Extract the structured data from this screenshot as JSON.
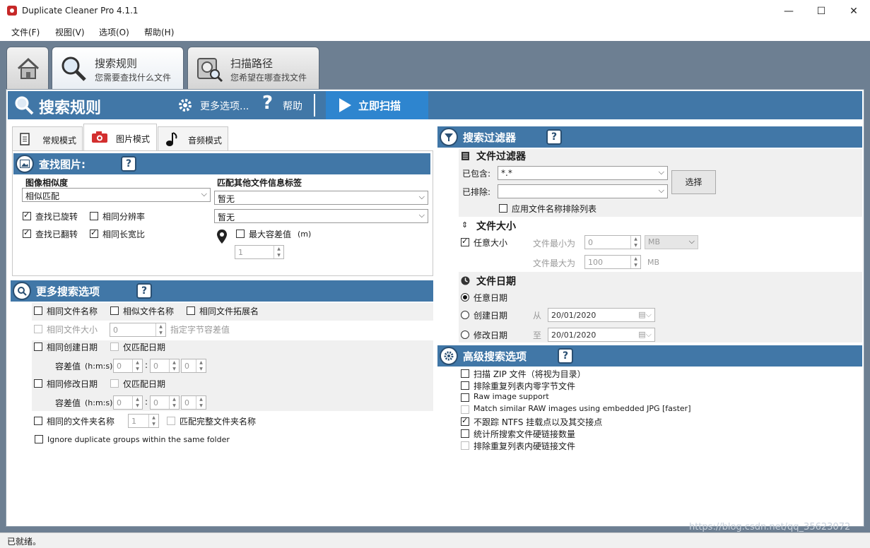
{
  "window": {
    "title": "Duplicate Cleaner Pro 4.1.1",
    "minimize": "—",
    "maximize": "☐",
    "close": "✕"
  },
  "menu": [
    "文件(F)",
    "视图(V)",
    "选项(O)",
    "帮助(H)"
  ],
  "tabs": [
    {
      "title": "",
      "subtitle": ""
    },
    {
      "title": "搜索规则",
      "subtitle": "您需要查找什么文件"
    },
    {
      "title": "扫描路径",
      "subtitle": "您希望在哪查找文件"
    }
  ],
  "header": {
    "title": "搜索规则",
    "more": "更多选项...",
    "help": "帮助",
    "scan": "立即扫描"
  },
  "subtabs": [
    "常规模式",
    "图片模式",
    "音频模式"
  ],
  "find_images": {
    "title": "查找图片:",
    "similarity_label": "图像相似度",
    "similarity_value": "相似匹配",
    "tags_label": "匹配其他文件信息标签",
    "tag1": "暂无",
    "tag2": "暂无",
    "rotated": "查找已旋转",
    "flipped": "查找已翻转",
    "same_resolution": "相同分辨率",
    "same_aspect": "相同长宽比",
    "max_tolerance": "最大容差值",
    "max_tolerance_unit": "(m)",
    "tolerance_value": "1"
  },
  "more_search": {
    "title": "更多搜索选项",
    "same_name": "相同文件名称",
    "similar_name": "相似文件名称",
    "same_ext": "相同文件拓展名",
    "same_size": "相同文件大小",
    "size_value": "0",
    "byte_tol": "指定字节容差值",
    "same_created": "相同创建日期",
    "date_only_1": "仅匹配日期",
    "tolerance": "容差值",
    "hms": "(h:m:s)",
    "zero": "0",
    "colon": ":",
    "same_modified": "相同修改日期",
    "date_only_2": "仅匹配日期",
    "same_folder": "相同的文件夹名称",
    "folder_value": "1",
    "full_folder": "匹配完整文件夹名称",
    "ignore_groups": "Ignore duplicate groups within the same folder"
  },
  "filters": {
    "title": "搜索过滤器",
    "file_filter": "文件过滤器",
    "include_label": "已包含:",
    "include_value": "*.*",
    "exclude_label": "已排除:",
    "exclude_value": "",
    "choose": "选择",
    "apply_exclude": "应用文件名称排除列表",
    "file_size": "文件大小",
    "any_size": "任意大小",
    "min_label": "文件最小为",
    "min_value": "0",
    "max_label": "文件最大为",
    "max_value": "100",
    "unit_select": "MB",
    "unit_text": "MB",
    "file_date": "文件日期",
    "any_date": "任意日期",
    "created": "创建日期",
    "from": "从",
    "from_date": "20/01/2020",
    "modified": "修改日期",
    "to": "至",
    "to_date": "20/01/2020"
  },
  "advanced": {
    "title": "高级搜索选项",
    "items": [
      {
        "label": "扫描 ZIP 文件（将视为目录）",
        "checked": false,
        "disabled": false
      },
      {
        "label": "排除重复列表内零字节文件",
        "checked": false,
        "disabled": false
      },
      {
        "label": "Raw image support",
        "checked": false,
        "disabled": false
      },
      {
        "label": "Match similar RAW images using embedded JPG [faster]",
        "checked": false,
        "disabled": true
      },
      {
        "label": "不跟踪 NTFS 挂载点以及其交接点",
        "checked": true,
        "disabled": false
      },
      {
        "label": "统计所搜索文件硬链接数量",
        "checked": false,
        "disabled": false
      },
      {
        "label": "排除重复列表内硬链接文件",
        "checked": false,
        "disabled": true
      }
    ]
  },
  "status": "已就绪。",
  "watermark": "https://blog.csdn.net/qq_35623072"
}
